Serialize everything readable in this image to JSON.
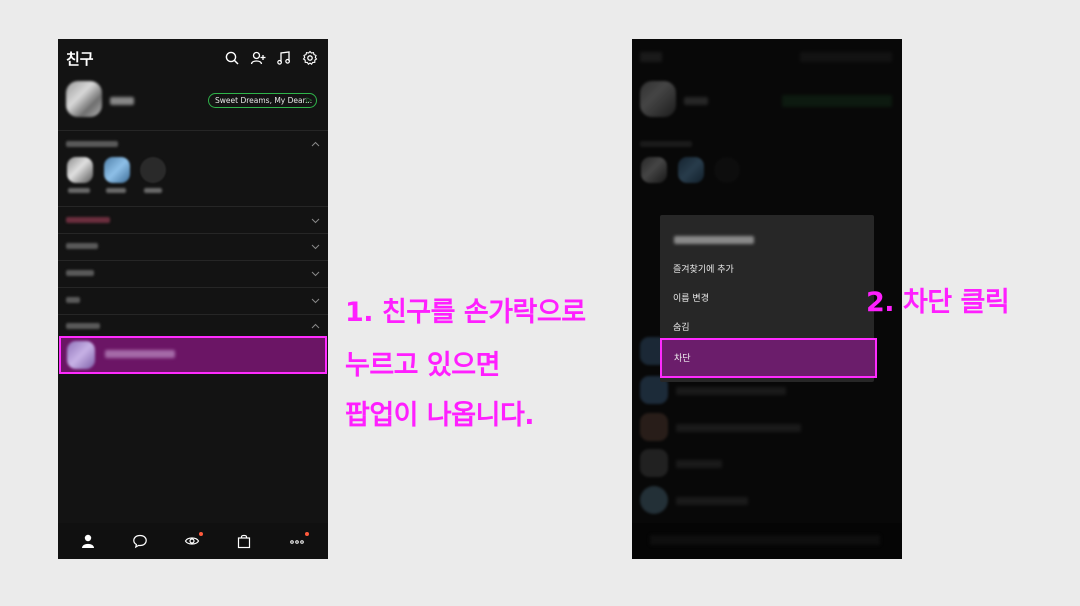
{
  "phone1": {
    "title": "친구",
    "music_status": "Sweet Dreams, My Dear...",
    "icons": [
      "search-icon",
      "add-friend-icon",
      "music-icon",
      "gear-icon"
    ],
    "nav": [
      "person-icon",
      "chat-icon",
      "view-icon",
      "shopping-bag-icon",
      "more-icon"
    ]
  },
  "phone2": {
    "popup_items": [
      "즐겨찾기에 추가",
      "이름 변경",
      "숨김"
    ],
    "popup_block": "차단"
  },
  "annotations": {
    "step1_line1": "1. 친구를 손가락으로",
    "step1_line2": "누르고 있으면",
    "step1_line3": "팝업이 나옵니다.",
    "step2": "2. 차단 클릭"
  },
  "colors": {
    "highlight": "#ff2bff",
    "annotation": "#ff1fff",
    "music_accent": "#2fb34a"
  }
}
